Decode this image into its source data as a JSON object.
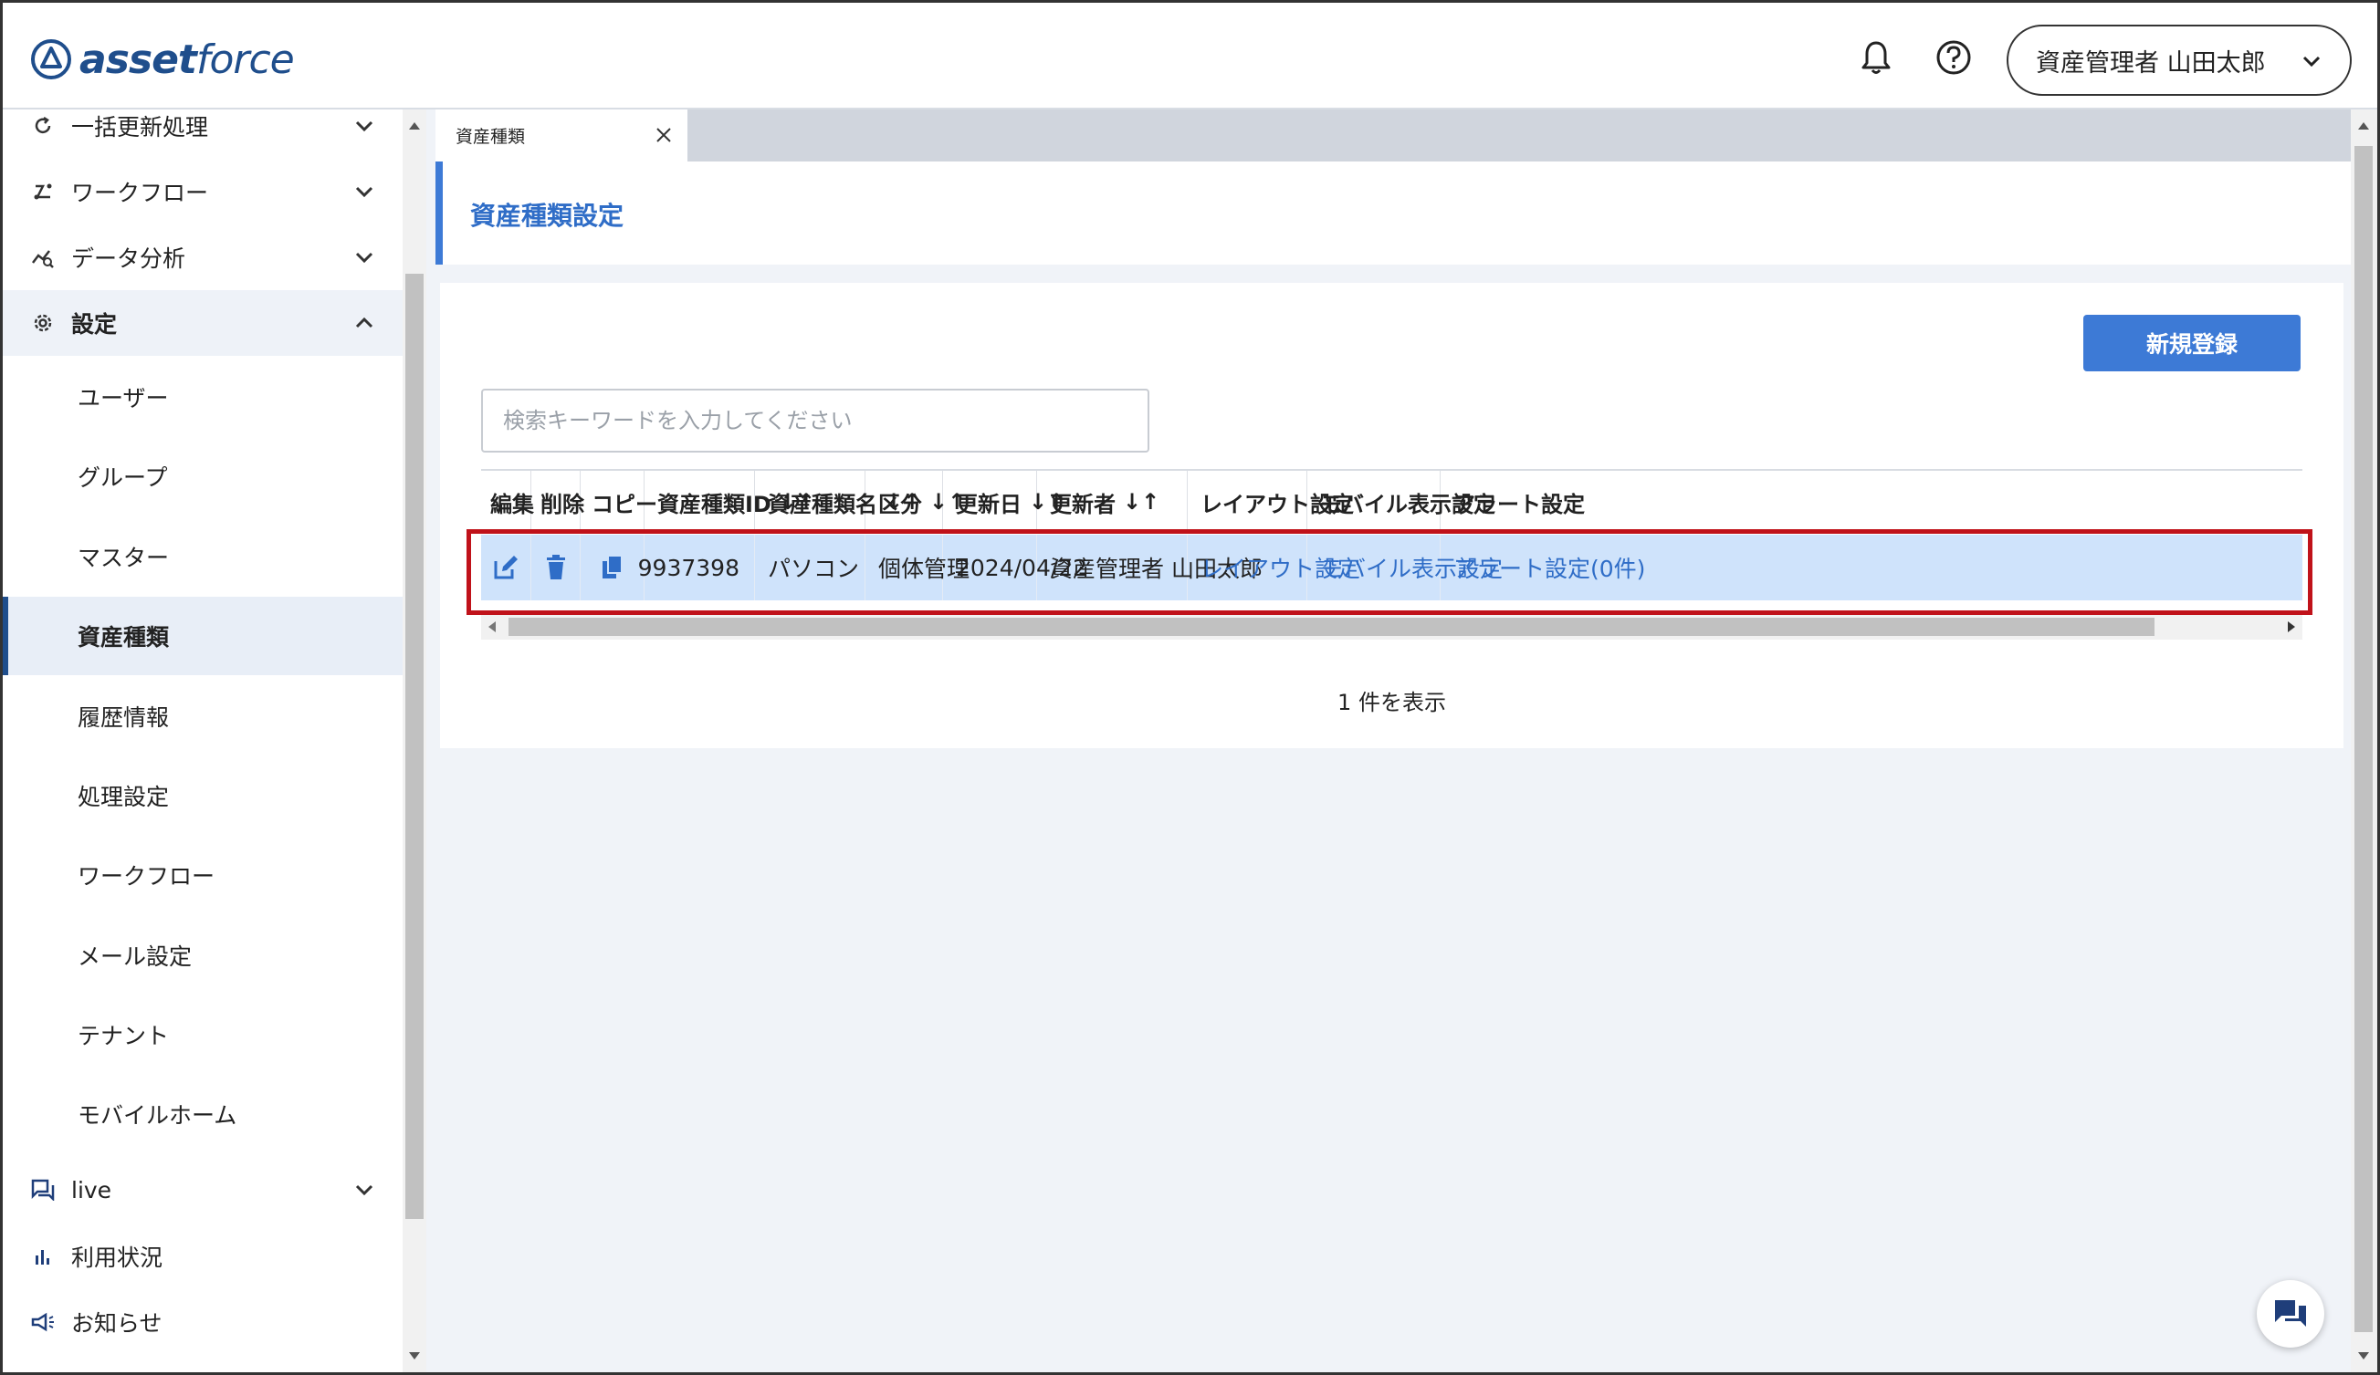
{
  "header": {
    "logo_text_bold": "asset",
    "logo_text_light": "force",
    "user_label": "資産管理者 山田太郎"
  },
  "sidebar": {
    "top_items": [
      {
        "label": "一括更新処理",
        "icon": "refresh-icon"
      },
      {
        "label": "ワークフロー",
        "icon": "workflow-icon"
      },
      {
        "label": "データ分析",
        "icon": "analytics-icon"
      },
      {
        "label": "設定",
        "icon": "gear-icon"
      }
    ],
    "sub_items": [
      {
        "label": "ユーザー"
      },
      {
        "label": "グループ"
      },
      {
        "label": "マスター"
      },
      {
        "label": "資産種類"
      },
      {
        "label": "履歴情報"
      },
      {
        "label": "処理設定"
      },
      {
        "label": "ワークフロー"
      },
      {
        "label": "メール設定"
      },
      {
        "label": "テナント"
      },
      {
        "label": "モバイルホーム"
      }
    ],
    "bottom_items": [
      {
        "label": "live",
        "icon": "chat-icon"
      },
      {
        "label": "利用状況",
        "icon": "bar-chart-icon"
      },
      {
        "label": "お知らせ",
        "icon": "megaphone-icon"
      }
    ]
  },
  "tabs": [
    {
      "label": "資産種類"
    }
  ],
  "page": {
    "title": "資産種類設定",
    "new_button": "新規登録",
    "search_placeholder": "検索キーワードを入力してください",
    "count_text": "1 件を表示"
  },
  "table": {
    "columns": [
      "編集",
      "削除",
      "コピー",
      "資産種類ID",
      "資産種類名",
      "区分",
      "更新日",
      "更新者",
      "レイアウト設定",
      "モバイル表示設定",
      "アラート設定"
    ],
    "sortable": [
      false,
      false,
      false,
      true,
      true,
      true,
      true,
      true,
      false,
      false,
      false
    ],
    "sort_glyph": "↓↑",
    "rows": [
      {
        "id": "9937398",
        "name": "パソコン",
        "category": "個体管理",
        "updated": "2024/04/22",
        "updater": "資産管理者 山田太郎",
        "layout": "レイアウト設定",
        "mobile": "モバイル表示設定",
        "alert": "アラート設定(0件)"
      }
    ]
  },
  "colors": {
    "accent": "#3d7ad6",
    "row_selected": "#cfe3fb",
    "highlight_border": "#c0121a",
    "brand": "#1f4e8c"
  }
}
